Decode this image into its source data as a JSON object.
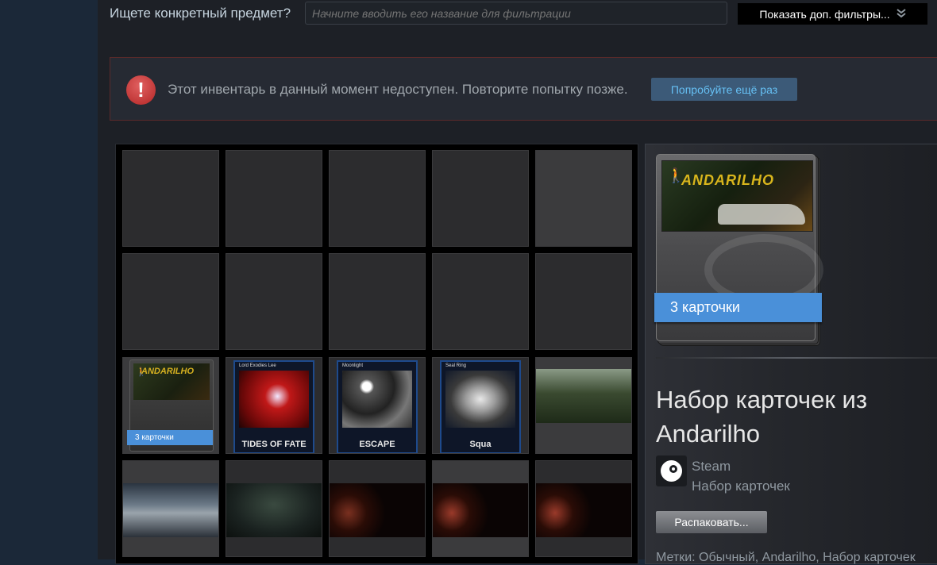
{
  "filter": {
    "label": "Ищете конкретный предмет?",
    "placeholder": "Начните вводить его название для фильтрации",
    "more_filters_label": "Показать доп. фильтры...",
    "more_filters_icon": "double-chevron-down-icon"
  },
  "error": {
    "icon": "exclamation-icon",
    "message": "Этот инвентарь в данный момент недоступен. Повторите попытку позже.",
    "retry_label": "Попробуйте ещё раз"
  },
  "grid": {
    "card_pack": {
      "logo": "ANDARILHO",
      "count_label": "3 карточки"
    },
    "trading_cards": [
      {
        "name": "Lord Exodies Lee",
        "caption": "TIDES OF FATE"
      },
      {
        "name": "Moonlight",
        "caption": "ESCAPE"
      },
      {
        "name": "Seal Ring",
        "caption": "Squa"
      }
    ]
  },
  "details": {
    "card_logo": "ANDARILHO",
    "count_label": "3 карточки",
    "title": "Набор карточек из Andarilho",
    "game": "Steam",
    "type": "Набор карточек",
    "unpack_label": "Распаковать...",
    "tags": "Метки: Обычный, Andarilho, Набор карточек"
  },
  "colors": {
    "accent_blue": "#4a90d9",
    "link_blue": "#66c0f4",
    "error_red": "#c23c3c"
  }
}
